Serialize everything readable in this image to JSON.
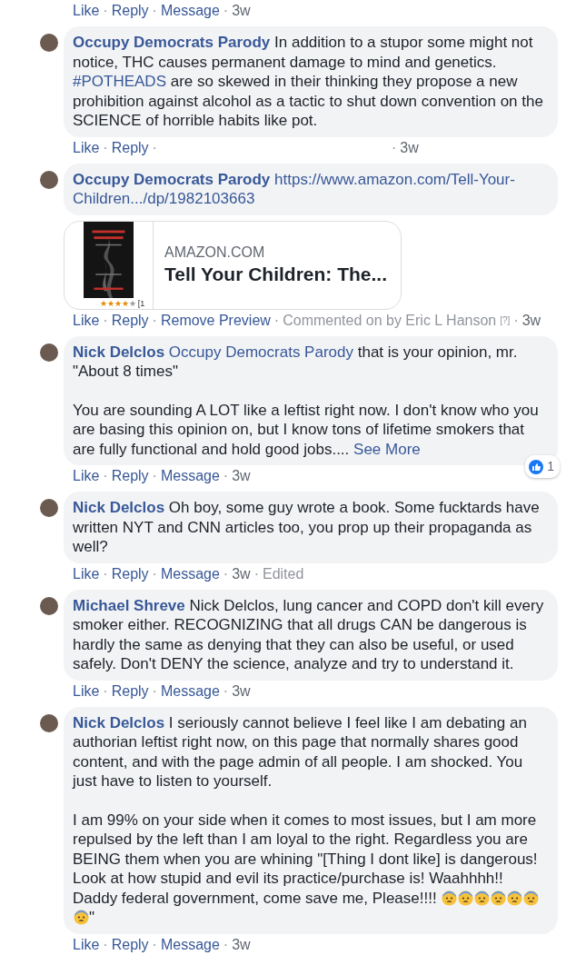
{
  "separator": "·",
  "top_actions": [
    {
      "text": "Like",
      "kind": "link"
    },
    {
      "text": "Reply",
      "kind": "link"
    },
    {
      "text": "Message",
      "kind": "link"
    },
    {
      "text": "3w",
      "kind": "time"
    }
  ],
  "comments": [
    {
      "paragraphs": [
        [
          {
            "kind": "author",
            "text": "Occupy Democrats Parody"
          },
          {
            "kind": "text",
            "text": " In addition to a stupor some might not notice, THC causes permanent damage to mind and genetics. "
          },
          {
            "kind": "hashtag",
            "text": "#POTHEADS"
          },
          {
            "kind": "text",
            "text": " are so skewed in their thinking they propose a new prohibition against alcohol as a tactic to shut down convention on the SCIENCE of horrible habits like pot."
          }
        ]
      ],
      "actions": [
        {
          "text": "Like",
          "kind": "link"
        },
        {
          "text": "Reply",
          "kind": "link"
        },
        {
          "kind": "redacted"
        },
        {
          "text": "3w",
          "kind": "time"
        }
      ]
    },
    {
      "paragraphs": [
        [
          {
            "kind": "author",
            "text": "Occupy Democrats Parody"
          },
          {
            "kind": "url",
            "text": " https://www.amazon.com/Tell-Your-Children.../dp/1982103663"
          }
        ]
      ],
      "preview": {
        "domain": "AMAZON.COM",
        "title": "Tell Your Children: The...",
        "stars": 4,
        "rating_count": "[1"
      },
      "actions": [
        {
          "text": "Like",
          "kind": "link"
        },
        {
          "text": "Reply",
          "kind": "link"
        },
        {
          "text": "Remove Preview",
          "kind": "link"
        },
        {
          "text": "Commented on by Eric L Hanson",
          "kind": "meta",
          "note": "[?]"
        },
        {
          "text": "3w",
          "kind": "time"
        }
      ]
    },
    {
      "paragraphs": [
        [
          {
            "kind": "author",
            "text": "Nick Delclos"
          },
          {
            "kind": "mention",
            "text": "Occupy Democrats Parody"
          },
          {
            "kind": "text",
            "text": " that is your opinion, mr. \"About 8 times\""
          }
        ],
        [
          {
            "kind": "text",
            "text": "You are sounding A LOT like a leftist right now. I don't know who you are basing this opinion on, but I know tons of lifetime smokers that are fully functional and hold good jobs.... "
          },
          {
            "kind": "see_more",
            "text": "See More"
          }
        ]
      ],
      "reactions": "1",
      "actions": [
        {
          "text": "Like",
          "kind": "link"
        },
        {
          "text": "Reply",
          "kind": "link"
        },
        {
          "text": "Message",
          "kind": "link"
        },
        {
          "text": "3w",
          "kind": "time"
        }
      ]
    },
    {
      "paragraphs": [
        [
          {
            "kind": "author",
            "text": "Nick Delclos"
          },
          {
            "kind": "text",
            "text": " Oh boy, some guy wrote a book. Some fucktards have written NYT and CNN articles too, you prop up their propaganda as well?"
          }
        ]
      ],
      "actions": [
        {
          "text": "Like",
          "kind": "link"
        },
        {
          "text": "Reply",
          "kind": "link"
        },
        {
          "text": "Message",
          "kind": "link"
        },
        {
          "text": "3w",
          "kind": "time"
        },
        {
          "text": "Edited",
          "kind": "meta"
        }
      ]
    },
    {
      "paragraphs": [
        [
          {
            "kind": "author",
            "text": "Michael Shreve"
          },
          {
            "kind": "text",
            "text": " Nick Delclos, lung cancer and COPD don't kill every smoker either. RECOGNIZING that all drugs CAN be dangerous is hardly the same as denying that they can also be useful, or used safely. Don't DENY the science, analyze and try to understand it."
          }
        ]
      ],
      "actions": [
        {
          "text": "Like",
          "kind": "link"
        },
        {
          "text": "Reply",
          "kind": "link"
        },
        {
          "text": "Message",
          "kind": "link"
        },
        {
          "text": "3w",
          "kind": "time"
        }
      ]
    },
    {
      "paragraphs": [
        [
          {
            "kind": "author",
            "text": "Nick Delclos"
          },
          {
            "kind": "text",
            "text": " I seriously cannot believe I feel like I am debating an authorian leftist right now, on this page that normally shares good content, and with the page admin of all people. I am shocked. You just have to listen to yourself."
          }
        ],
        [
          {
            "kind": "text",
            "text": "I am 99% on your side when it comes to most issues, but I am more repulsed by the left than I am loyal to the right. Regardless you are BEING them when you are whining \"[Thing I dont like] is dangerous! Look at how stupid and evil its practice/purchase is! Waahhhh!! Daddy federal government, come save me, Please!!!! "
          },
          {
            "kind": "emoji"
          },
          {
            "kind": "emoji"
          },
          {
            "kind": "emoji"
          },
          {
            "kind": "emoji"
          },
          {
            "kind": "emoji"
          },
          {
            "kind": "emoji"
          },
          {
            "kind": "emoji"
          },
          {
            "kind": "text",
            "text": "\""
          }
        ]
      ],
      "actions": [
        {
          "text": "Like",
          "kind": "link"
        },
        {
          "text": "Reply",
          "kind": "link"
        },
        {
          "text": "Message",
          "kind": "link"
        },
        {
          "text": "3w",
          "kind": "time"
        }
      ]
    }
  ]
}
